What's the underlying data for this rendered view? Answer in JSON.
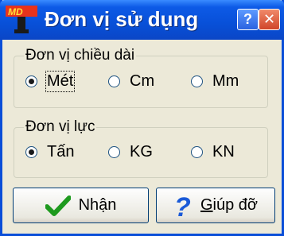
{
  "window": {
    "title": "Đơn vị sử dụng",
    "icon": "app-logo-icon",
    "title_buttons": {
      "help": "?",
      "close": "✕"
    }
  },
  "length_group": {
    "title": "Đơn vị chiều dài",
    "options": [
      {
        "label": "Mét",
        "checked": true
      },
      {
        "label": "Cm",
        "checked": false
      },
      {
        "label": "Mm",
        "checked": false
      }
    ]
  },
  "force_group": {
    "title": "Đơn vị lực",
    "options": [
      {
        "label": "Tấn",
        "checked": true
      },
      {
        "label": "KG",
        "checked": false
      },
      {
        "label": "KN",
        "checked": false
      }
    ]
  },
  "buttons": {
    "ok": {
      "label": "Nhận",
      "icon": "checkmark-icon",
      "icon_color": "#1e9a1e"
    },
    "help": {
      "label_hotkey": "G",
      "label_rest": "iúp đỡ",
      "icon": "question-icon",
      "icon_color": "#1a5ad8"
    }
  },
  "colors": {
    "titlebar": "#0a52dc",
    "face": "#ece9d8"
  }
}
